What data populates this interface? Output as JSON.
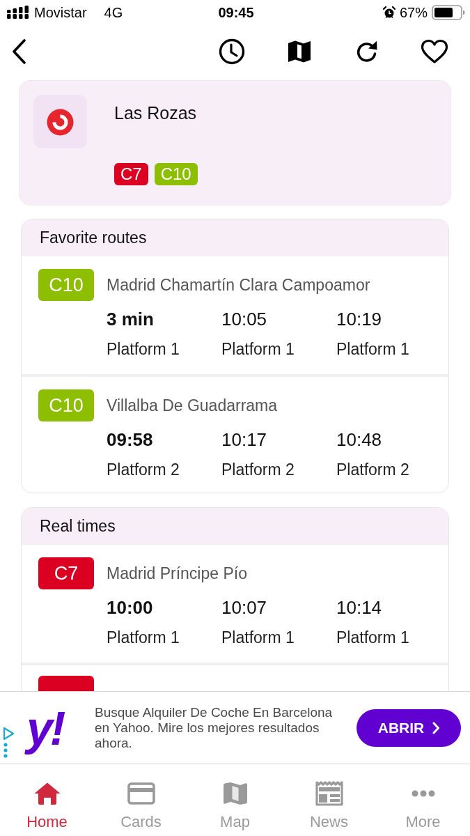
{
  "status_bar": {
    "carrier": "Movistar",
    "network": "4G",
    "time": "09:45",
    "battery": "67%"
  },
  "station": {
    "name": "Las Rozas",
    "lines": [
      {
        "label": "C7",
        "color": "#db0021"
      },
      {
        "label": "C10",
        "color": "#8dbe00"
      }
    ]
  },
  "sections": [
    {
      "title": "Favorite routes",
      "routes": [
        {
          "line": {
            "label": "C10",
            "color": "#8dbe00"
          },
          "destination": "Madrid Chamartín Clara Campoamor",
          "departures": [
            {
              "time": "3 min",
              "platform": "Platform 1"
            },
            {
              "time": "10:05",
              "platform": "Platform 1"
            },
            {
              "time": "10:19",
              "platform": "Platform 1"
            }
          ]
        },
        {
          "line": {
            "label": "C10",
            "color": "#8dbe00"
          },
          "destination": "Villalba De Guadarrama",
          "departures": [
            {
              "time": "09:58",
              "platform": "Platform 2"
            },
            {
              "time": "10:17",
              "platform": "Platform 2"
            },
            {
              "time": "10:48",
              "platform": "Platform 2"
            }
          ]
        }
      ]
    },
    {
      "title": "Real times",
      "routes": [
        {
          "line": {
            "label": "C7",
            "color": "#db0021"
          },
          "destination": "Madrid Príncipe Pío",
          "departures": [
            {
              "time": "10:00",
              "platform": "Platform 1"
            },
            {
              "time": "10:07",
              "platform": "Platform 1"
            },
            {
              "time": "10:14",
              "platform": "Platform 1"
            }
          ]
        },
        {
          "line": {
            "color": "#db0021"
          }
        }
      ]
    }
  ],
  "ad": {
    "logo": "y!",
    "text": "Busque Alquiler De Coche En Barcelona en Yahoo. Mire los mejores resultados ahora.",
    "button": "ABRIR"
  },
  "tab_bar": [
    {
      "label": "Home",
      "selected": true
    },
    {
      "label": "Cards",
      "selected": false
    },
    {
      "label": "Map",
      "selected": false
    },
    {
      "label": "News",
      "selected": false
    },
    {
      "label": "More",
      "selected": false
    }
  ]
}
